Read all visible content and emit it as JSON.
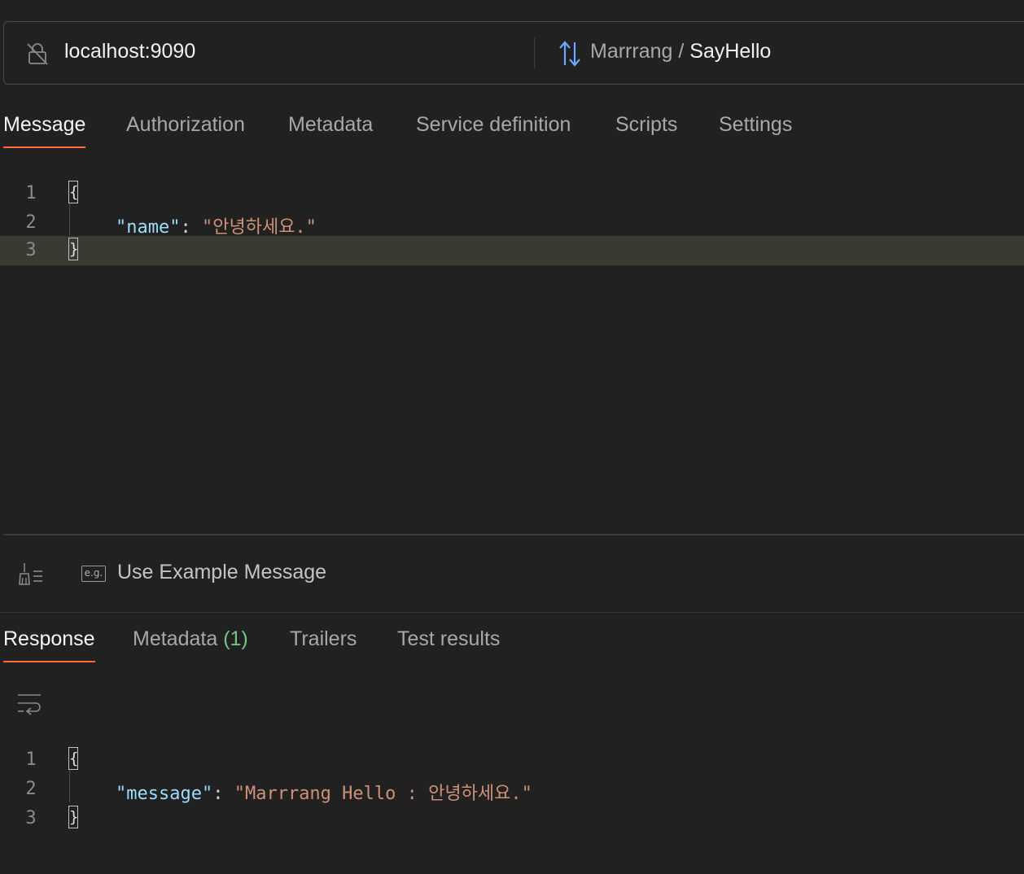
{
  "request": {
    "url": "localhost:9090",
    "service": "Marrrang",
    "separator": " / ",
    "method": "SayHello"
  },
  "request_tabs": [
    {
      "label": "Message",
      "active": true
    },
    {
      "label": "Authorization",
      "active": false
    },
    {
      "label": "Metadata",
      "active": false
    },
    {
      "label": "Service definition",
      "active": false
    },
    {
      "label": "Scripts",
      "active": false
    },
    {
      "label": "Settings",
      "active": false
    }
  ],
  "message_editor": {
    "lines": [
      {
        "num": "1",
        "text": "{"
      },
      {
        "num": "2",
        "key": "\"name\"",
        "sep": ": ",
        "value": "\"안녕하세요.\""
      },
      {
        "num": "3",
        "text": "}"
      }
    ]
  },
  "actions": {
    "example_badge": "e.g.",
    "use_example_label": "Use Example Message"
  },
  "response_tabs": [
    {
      "label": "Response",
      "active": true
    },
    {
      "label": "Metadata",
      "count": "(1)",
      "active": false
    },
    {
      "label": "Trailers",
      "active": false
    },
    {
      "label": "Test results",
      "active": false
    }
  ],
  "response_editor": {
    "lines": [
      {
        "num": "1",
        "text": "{"
      },
      {
        "num": "2",
        "key": "\"message\"",
        "sep": ": ",
        "value": "\"Marrrang Hello : 안녕하세요.\""
      },
      {
        "num": "3",
        "text": "}"
      }
    ]
  },
  "colors": {
    "background": "#212121",
    "accent": "#ff6c37",
    "json_key": "#9cdcfe",
    "json_string": "#ce9178",
    "count": "#74c685",
    "method_icon": "#6ea8fe"
  },
  "icons": {
    "lock": "unlocked-lock-icon",
    "method": "bidirectional-arrows-icon",
    "broom": "beautify-broom-icon",
    "example": "eg-badge-icon",
    "wrap": "line-wrap-icon"
  }
}
